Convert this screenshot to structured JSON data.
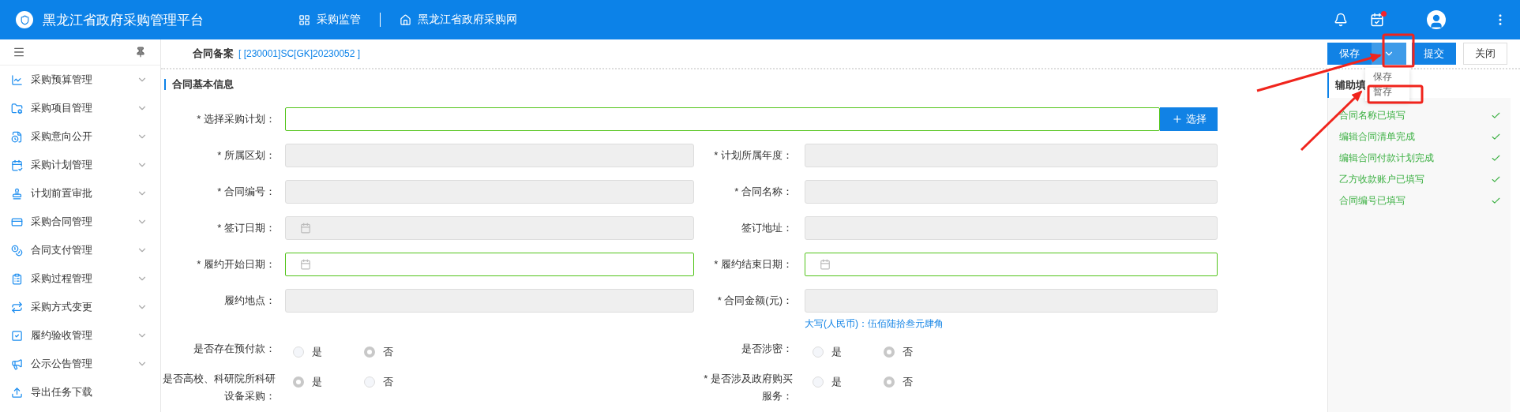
{
  "header": {
    "title": "黑龙江省政府采购管理平台",
    "nav": [
      {
        "label": "采购监管",
        "kind": "grid"
      },
      {
        "label": "黑龙江省政府采购网",
        "kind": "home"
      }
    ],
    "has_unread": true
  },
  "sidebar": {
    "items": [
      {
        "label": "采购预算管理",
        "kind": "chart",
        "expandable": true
      },
      {
        "label": "采购项目管理",
        "kind": "folder",
        "expandable": true
      },
      {
        "label": "采购意向公开",
        "kind": "doc",
        "expandable": true
      },
      {
        "label": "采购计划管理",
        "kind": "calendar",
        "expandable": true
      },
      {
        "label": "计划前置审批",
        "kind": "stamp",
        "expandable": true
      },
      {
        "label": "采购合同管理",
        "kind": "card",
        "expandable": true
      },
      {
        "label": "合同支付管理",
        "kind": "coins",
        "expandable": true
      },
      {
        "label": "采购过程管理",
        "kind": "clipboard",
        "expandable": true
      },
      {
        "label": "采购方式变更",
        "kind": "swap",
        "expandable": true
      },
      {
        "label": "履约验收管理",
        "kind": "check",
        "expandable": true
      },
      {
        "label": "公示公告管理",
        "kind": "notice",
        "expandable": true
      },
      {
        "label": "导出任务下载",
        "kind": "upload",
        "expandable": false
      }
    ]
  },
  "page": {
    "title": "合同备案",
    "code": "[ [230001]SC[GK]20230052 ]"
  },
  "toolbar": {
    "save": "保存",
    "submit": "提交",
    "close": "关闭",
    "menu_open": true,
    "menu": [
      "保存",
      "暂存"
    ]
  },
  "section": {
    "title": "合同基本信息"
  },
  "fields": [
    {
      "label": "* 选择采购计划：",
      "kind": "picker",
      "disabled": false,
      "button": "选择"
    },
    {
      "label": "* 所属区划：",
      "kind": "text",
      "disabled": true
    },
    {
      "label": "* 计划所属年度：",
      "kind": "text",
      "disabled": true
    },
    {
      "label": "* 合同编号：",
      "kind": "text",
      "disabled": true
    },
    {
      "label": "* 合同名称：",
      "kind": "text",
      "disabled": true
    },
    {
      "label": "* 签订日期：",
      "kind": "date",
      "disabled": true
    },
    {
      "label": "签订地址：",
      "kind": "text",
      "disabled": true
    },
    {
      "label": "* 履约开始日期：",
      "kind": "date",
      "disabled": false
    },
    {
      "label": "* 履约结束日期：",
      "kind": "date",
      "disabled": false
    },
    {
      "label": "履约地点：",
      "kind": "text",
      "disabled": true
    },
    {
      "label": "* 合同金额(元)：",
      "kind": "text",
      "disabled": true,
      "hint": "大写(人民币)：伍佰陆拾叁元肆角"
    }
  ],
  "radios": [
    {
      "label": "是否存在预付款：",
      "options": [
        {
          "label": "是",
          "selected": false
        },
        {
          "label": "否",
          "selected": true
        }
      ]
    },
    {
      "label": "是否涉密：",
      "options": [
        {
          "label": "是",
          "selected": false
        },
        {
          "label": "否",
          "selected": true
        }
      ]
    },
    {
      "label": "是否高校、科研院所科研设备采购：",
      "options": [
        {
          "label": "是",
          "selected": true
        },
        {
          "label": "否",
          "selected": false
        }
      ]
    },
    {
      "label": "* 是否涉及政府购买服务：",
      "options": [
        {
          "label": "是",
          "selected": false
        },
        {
          "label": "否",
          "selected": true
        }
      ]
    }
  ],
  "assist": {
    "title": "辅助填",
    "items": [
      {
        "label": "合同名称已填写",
        "done": true
      },
      {
        "label": "编辑合同清单完成",
        "done": true
      },
      {
        "label": "编辑合同付款计划完成",
        "done": true
      },
      {
        "label": "乙方收款账户已填写",
        "done": true
      },
      {
        "label": "合同编号已填写",
        "done": true
      }
    ]
  }
}
